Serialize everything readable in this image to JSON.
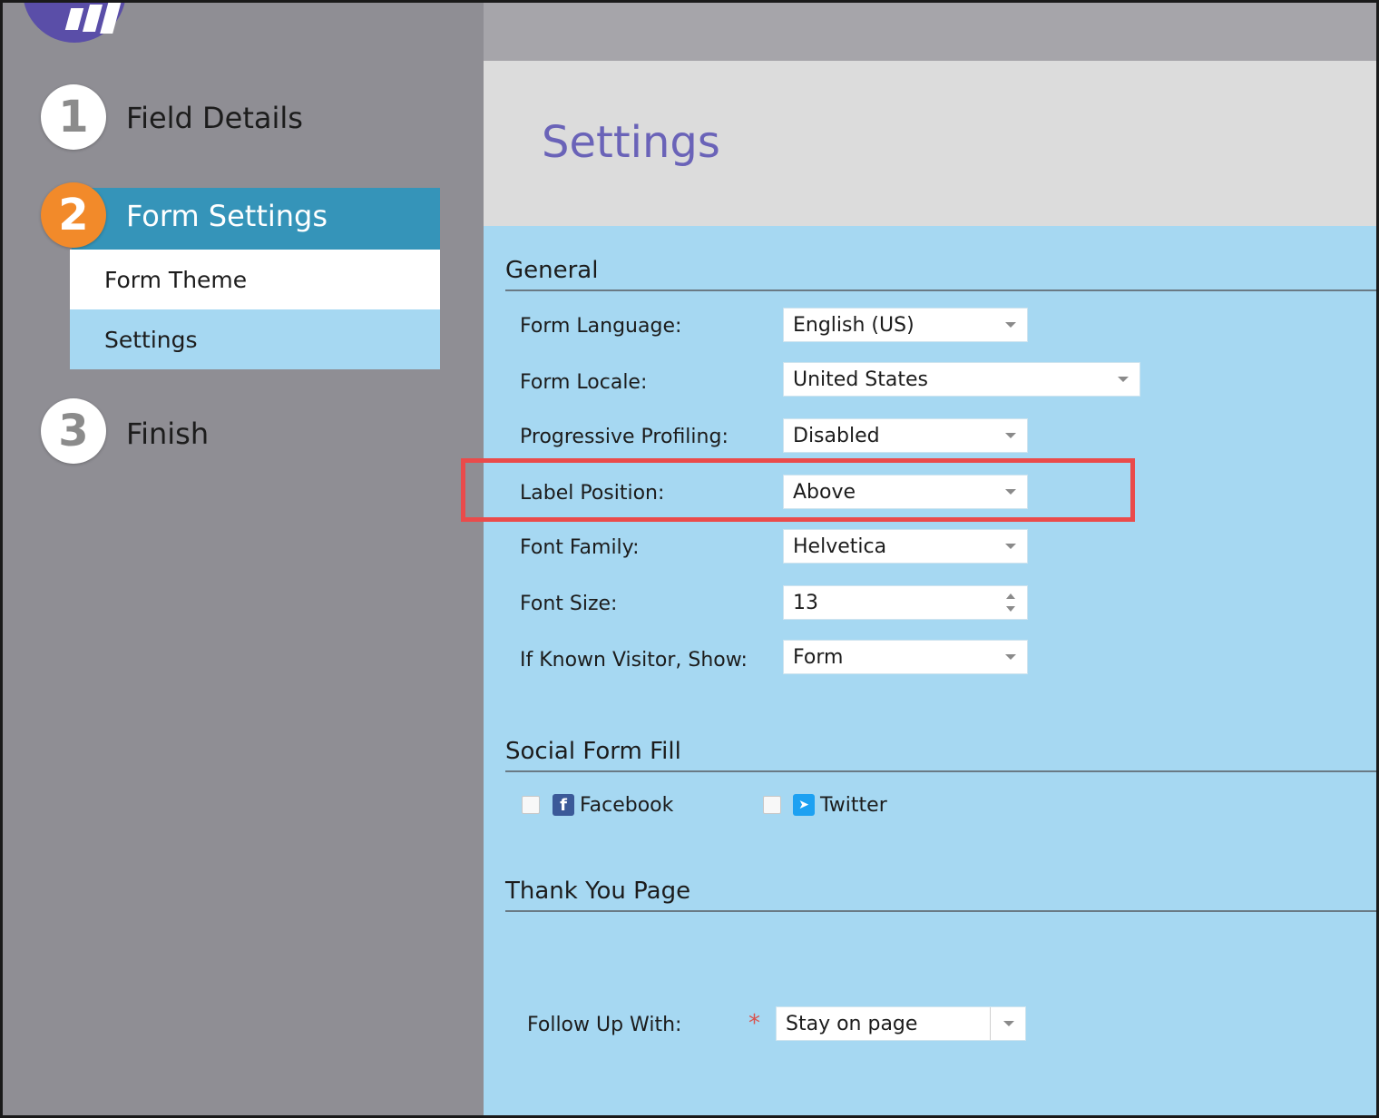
{
  "sidebar": {
    "steps": [
      {
        "number": "1",
        "label": "Field Details"
      },
      {
        "number": "2",
        "label": "Form Settings"
      },
      {
        "number": "3",
        "label": "Finish"
      }
    ],
    "subitems": [
      "Form Theme",
      "Settings"
    ]
  },
  "page": {
    "title": "Settings"
  },
  "general": {
    "heading": "General",
    "rows": [
      {
        "label": "Form Language:",
        "value": "English (US)"
      },
      {
        "label": "Form Locale:",
        "value": "United States"
      },
      {
        "label": "Progressive Profiling:",
        "value": "Disabled"
      },
      {
        "label": "Label Position:",
        "value": "Above"
      },
      {
        "label": "Font Family:",
        "value": "Helvetica"
      },
      {
        "label": "Font Size:",
        "value": "13"
      },
      {
        "label": "If Known Visitor, Show:",
        "value": "Form"
      }
    ]
  },
  "social": {
    "heading": "Social Form Fill",
    "facebook": "Facebook",
    "twitter": "Twitter",
    "facebook_checked": false,
    "twitter_checked": false
  },
  "thankyou": {
    "heading": "Thank You Page",
    "follow_label": "Follow Up With:",
    "required_mark": "*",
    "follow_value": "Stay on page"
  },
  "colors": {
    "sidebar": "#8f8e94",
    "active_step": "#f28a2a",
    "active_bar": "#3594b9",
    "content_bg": "#a6d8f2",
    "title": "#6a63b8",
    "highlight": "#ea4b4b"
  }
}
